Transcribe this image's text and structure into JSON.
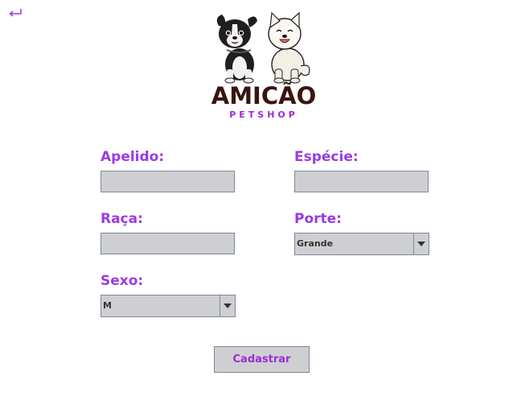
{
  "header": {
    "back_icon": "return-arrow-icon",
    "logo_icon": "dog-pair-logo-icon"
  },
  "brand": {
    "name": "AMICÃO",
    "subtitle": "PETSHOP",
    "name_color": "#3b1410",
    "subtitle_color": "#9a2bd6"
  },
  "form": {
    "apelido": {
      "label": "Apelido:",
      "value": ""
    },
    "especie": {
      "label": "Espécie:",
      "value": ""
    },
    "raca": {
      "label": "Raça:",
      "value": ""
    },
    "porte": {
      "label": "Porte:",
      "selected": "Grande"
    },
    "sexo": {
      "label": "Sexo:",
      "selected": "M"
    },
    "submit_label": "Cadastrar"
  },
  "colors": {
    "label": "#9a3be6",
    "field_background": "#cfcfd1",
    "field_border": "#7a8a9e"
  }
}
